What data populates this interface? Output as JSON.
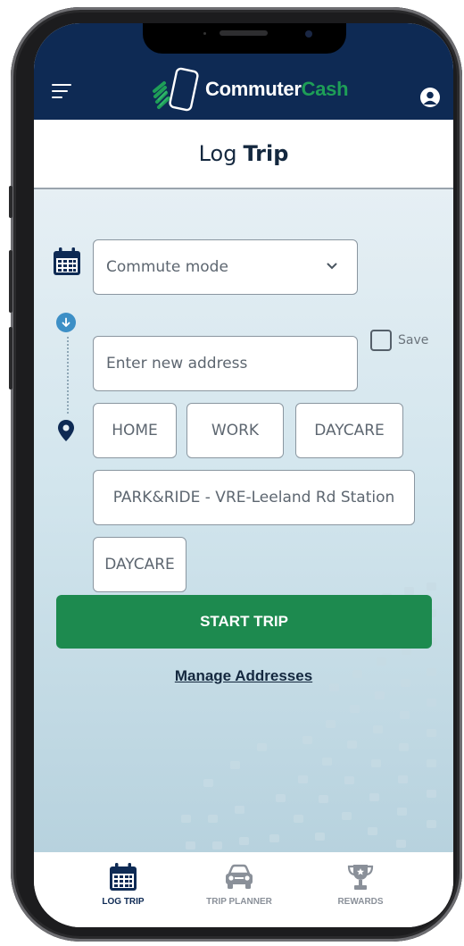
{
  "app": {
    "logo_part1": "Commuter",
    "logo_part2": "Cash"
  },
  "header": {
    "title_regular": "Log",
    "title_bold": "Trip"
  },
  "form": {
    "commute_mode_placeholder": "Commute mode",
    "address_placeholder": "Enter new address",
    "save_label": "Save",
    "chips": [
      "HOME",
      "WORK",
      "DAYCARE"
    ],
    "park_ride_chip": "PARK&RIDE - VRE-Leeland Rd Station",
    "extra_chip": "DAYCARE",
    "start_button": "START TRIP",
    "manage_link": "Manage Addresses"
  },
  "tabs": [
    {
      "label": "LOG TRIP",
      "icon": "calendar-icon",
      "active": true
    },
    {
      "label": "TRIP PLANNER",
      "icon": "car-icon",
      "active": false
    },
    {
      "label": "REWARDS",
      "icon": "trophy-icon",
      "active": false
    }
  ],
  "colors": {
    "navy": "#0e2a54",
    "brand_green": "#1e9e57",
    "start_button": "#1d8a4f",
    "route_blue": "#3d8fc6",
    "tab_inactive": "#8a9099"
  }
}
